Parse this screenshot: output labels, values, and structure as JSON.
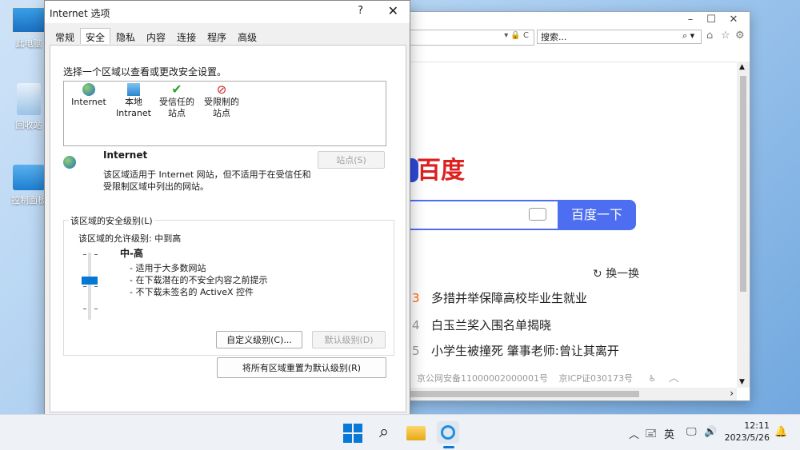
{
  "desktop": {
    "icons": [
      "此电脑",
      "回收站",
      "控制面板"
    ]
  },
  "browser": {
    "search_placeholder": "搜索...",
    "baidu_logo_text": "百度",
    "search_button": "百度一下",
    "refresh_label": "换一换",
    "hot_items": [
      {
        "num": "3",
        "text": "多措并举保障高校毕业生就业"
      },
      {
        "num": "4",
        "text": "白玉兰奖入围名单揭晓"
      },
      {
        "num": "5",
        "text": "小学生被撞死 肇事老师:曾让其离开"
      }
    ],
    "footer": [
      "京公网安备11000002000001号",
      "京ICP证030173号"
    ]
  },
  "dialog": {
    "title": "Internet 选项",
    "help": "?",
    "close": "✕",
    "tabs": [
      "常规",
      "安全",
      "隐私",
      "内容",
      "连接",
      "程序",
      "高级"
    ],
    "zone_prompt": "选择一个区域以查看或更改安全设置。",
    "zones": [
      {
        "line1": "Internet",
        "line2": ""
      },
      {
        "line1": "本地",
        "line2": "Intranet"
      },
      {
        "line1": "受信任的",
        "line2": "站点"
      },
      {
        "line1": "受限制的",
        "line2": "站点"
      }
    ],
    "zone_heading": "Internet",
    "zone_desc": "该区域适用于 Internet 网站，但不适用于在受信任和受限制区域中列出的网站。",
    "sites_button": "站点(S)",
    "security_group_label": "该区域的安全级别(L)",
    "allowed_levels": "该区域的允许级别: 中到高",
    "level_name": "中-高",
    "level_points": [
      "- 适用于大多数网站",
      "- 在下载潜在的不安全内容之前提示",
      "- 不下载未签名的 ActiveX 控件"
    ],
    "custom_level_button": "自定义级别(C)...",
    "default_level_button": "默认级别(D)",
    "reset_all_button": "将所有区域重置为默认级别(R)"
  },
  "taskbar": {
    "ime": "英",
    "time": "12:11",
    "date": "2023/5/26"
  }
}
